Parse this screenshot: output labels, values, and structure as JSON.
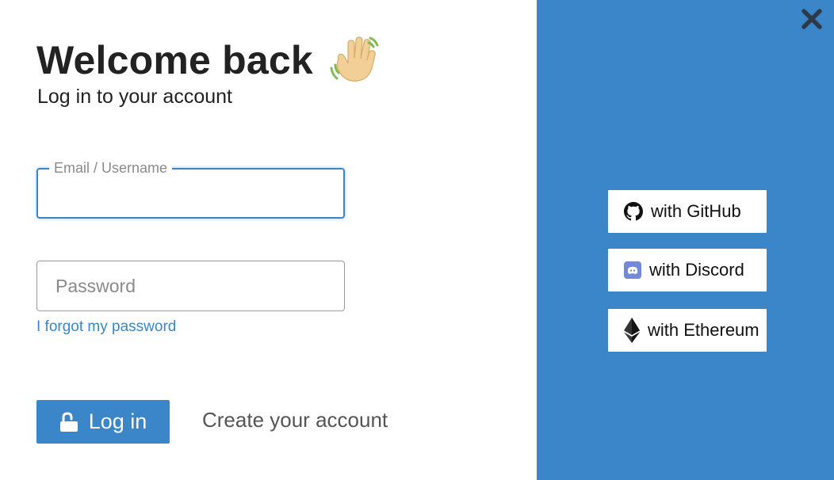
{
  "header": {
    "title": "Welcome back",
    "subtitle": "Log in to your account",
    "emoji_icon": "waving-hand-icon"
  },
  "login_form": {
    "email_label": "Email / Username",
    "email_value": "",
    "password_placeholder": "Password",
    "password_value": "",
    "forgot_link": "I forgot my password",
    "login_button": "Log in",
    "login_icon": "unlock-icon",
    "create_account_link": "Create your account"
  },
  "oauth": {
    "buttons": [
      {
        "label": "with GitHub",
        "icon": "github-icon"
      },
      {
        "label": "with Discord",
        "icon": "discord-icon"
      },
      {
        "label": "with Ethereum",
        "icon": "ethereum-icon"
      }
    ]
  },
  "controls": {
    "close_icon": "close-icon"
  },
  "colors": {
    "accent": "#3a86c8",
    "panel": "#3a86c8",
    "text": "#222222",
    "muted": "#8a8a8a",
    "discord": "#5865f2"
  }
}
